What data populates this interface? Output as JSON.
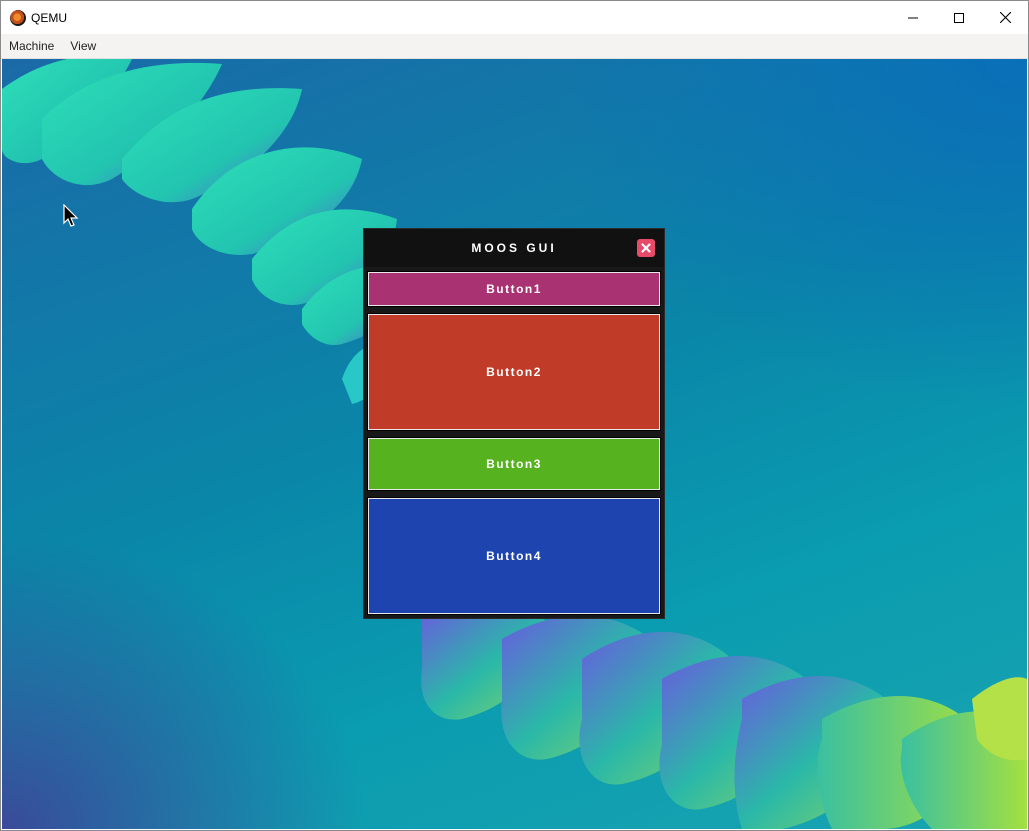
{
  "window": {
    "title": "QEMU",
    "app_icon": "qemu-logo-icon",
    "controls": [
      "minimize-icon",
      "maximize-icon",
      "close-icon"
    ]
  },
  "menubar": {
    "items": [
      {
        "label": "Machine"
      },
      {
        "label": "View"
      }
    ]
  },
  "moos": {
    "title": "MOOS GUI",
    "close_icon": "close-x-icon",
    "close_color": "#e84a6a",
    "buttons": [
      {
        "label": "Button1",
        "color": "#a83272"
      },
      {
        "label": "Button2",
        "color": "#c03c28"
      },
      {
        "label": "Button3",
        "color": "#56b21e"
      },
      {
        "label": "Button4",
        "color": "#1e44b0"
      }
    ]
  }
}
